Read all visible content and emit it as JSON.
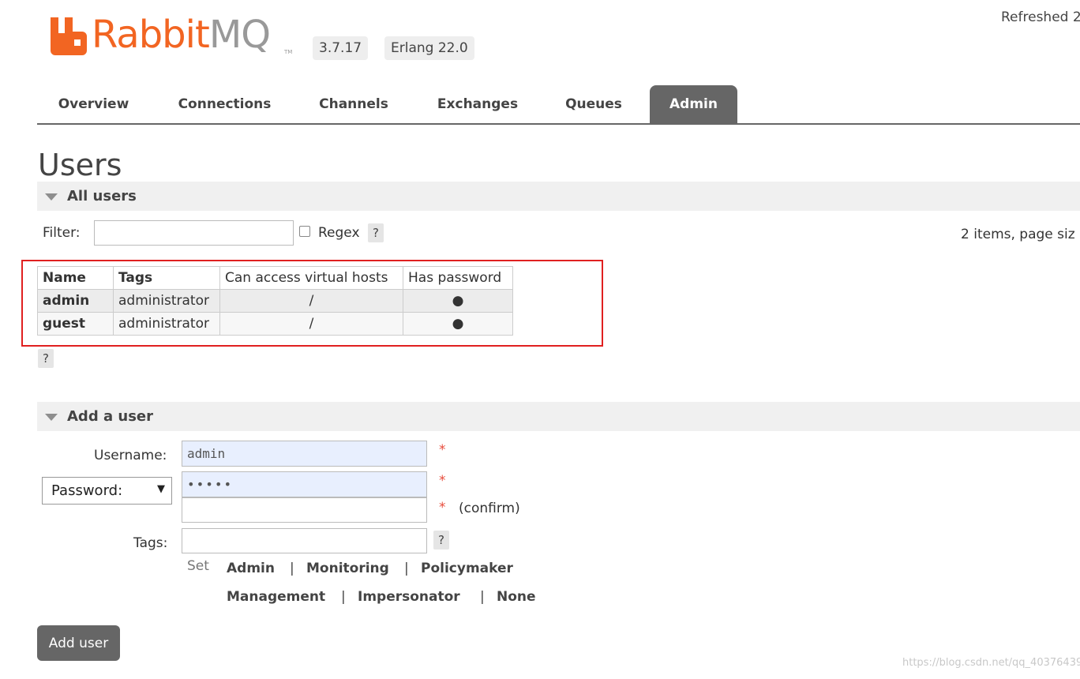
{
  "header": {
    "logo_text_rabbit": "Rabbit",
    "logo_text_mq": "MQ",
    "logo_tm": "TM",
    "version": "3.7.17",
    "erlang": "Erlang 22.0",
    "refreshed": "Refreshed 2",
    "brand_color": "#f26522"
  },
  "tabs": [
    {
      "label": "Overview",
      "active": false
    },
    {
      "label": "Connections",
      "active": false
    },
    {
      "label": "Channels",
      "active": false
    },
    {
      "label": "Exchanges",
      "active": false
    },
    {
      "label": "Queues",
      "active": false
    },
    {
      "label": "Admin",
      "active": true
    }
  ],
  "page": {
    "title": "Users"
  },
  "all_users": {
    "section_label": "All users",
    "filter_label": "Filter:",
    "filter_value": "",
    "regex_label": "Regex",
    "regex_checked": false,
    "help": "?",
    "pagination": "2 items, page siz",
    "columns": [
      "Name",
      "Tags",
      "Can access virtual hosts",
      "Has password"
    ],
    "rows": [
      {
        "name": "admin",
        "tags": "administrator",
        "vhosts": "/",
        "has_password": "●"
      },
      {
        "name": "guest",
        "tags": "administrator",
        "vhosts": "/",
        "has_password": "●"
      }
    ],
    "help_below": "?"
  },
  "add_user": {
    "section_label": "Add a user",
    "username_label": "Username:",
    "username_value": "admin",
    "password_mode": "Password:",
    "password_value": "•••••",
    "confirm_value": "",
    "confirm_label": "(confirm)",
    "required_mark": "*",
    "tags_label": "Tags:",
    "tags_value": "",
    "tags_help": "?",
    "set_label": "Set",
    "tag_options": [
      "Admin",
      "Monitoring",
      "Policymaker",
      "Management",
      "Impersonator",
      "None"
    ],
    "separator": "|",
    "submit_label": "Add user"
  },
  "watermark": "https://blog.csdn.net/qq_40376439"
}
